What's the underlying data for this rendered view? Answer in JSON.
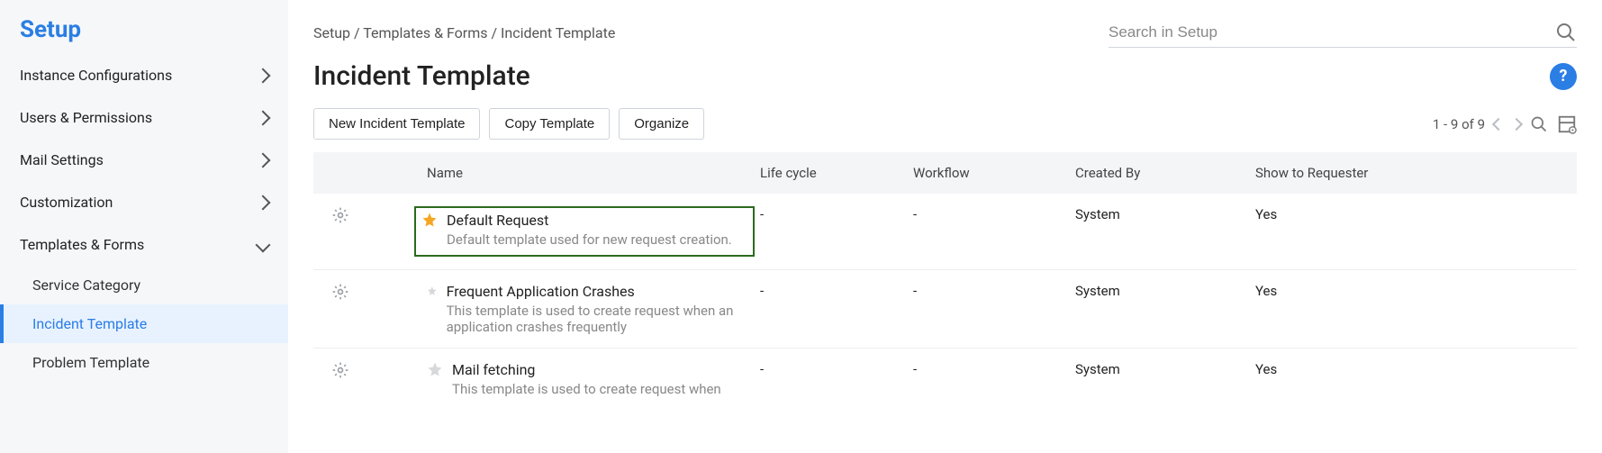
{
  "sidebar": {
    "title": "Setup",
    "items": [
      {
        "label": "Instance Configurations",
        "expanded": false
      },
      {
        "label": "Users & Permissions",
        "expanded": false
      },
      {
        "label": "Mail Settings",
        "expanded": false
      },
      {
        "label": "Customization",
        "expanded": false
      },
      {
        "label": "Templates & Forms",
        "expanded": true,
        "children": [
          {
            "label": "Service Category",
            "active": false
          },
          {
            "label": "Incident Template",
            "active": true
          },
          {
            "label": "Problem Template",
            "active": false
          }
        ]
      }
    ]
  },
  "breadcrumb": {
    "parts": [
      "Setup",
      "Templates & Forms",
      "Incident Template"
    ],
    "text": "Setup / Templates & Forms / Incident Template"
  },
  "search": {
    "placeholder": "Search in Setup"
  },
  "page_title": "Incident Template",
  "help_icon": "?",
  "toolbar": {
    "new_btn": "New Incident Template",
    "copy_btn": "Copy Template",
    "organize_btn": "Organize"
  },
  "pager": {
    "text": "1 - 9 of 9"
  },
  "table": {
    "columns": {
      "name": "Name",
      "life_cycle": "Life cycle",
      "workflow": "Workflow",
      "created_by": "Created By",
      "show_to_requester": "Show to Requester"
    },
    "rows": [
      {
        "starred": true,
        "highlight": true,
        "name": "Default Request",
        "desc": "Default template used for new request creation.",
        "life_cycle": "-",
        "workflow": "-",
        "created_by": "System",
        "show_to_requester": "Yes"
      },
      {
        "starred": false,
        "highlight": false,
        "name": "Frequent Application Crashes",
        "desc": "This template is used to create request when an application crashes frequently",
        "life_cycle": "-",
        "workflow": "-",
        "created_by": "System",
        "show_to_requester": "Yes"
      },
      {
        "starred": false,
        "highlight": false,
        "name": "Mail fetching",
        "desc": "This template is used to create request when",
        "life_cycle": "-",
        "workflow": "-",
        "created_by": "System",
        "show_to_requester": "Yes"
      }
    ]
  }
}
